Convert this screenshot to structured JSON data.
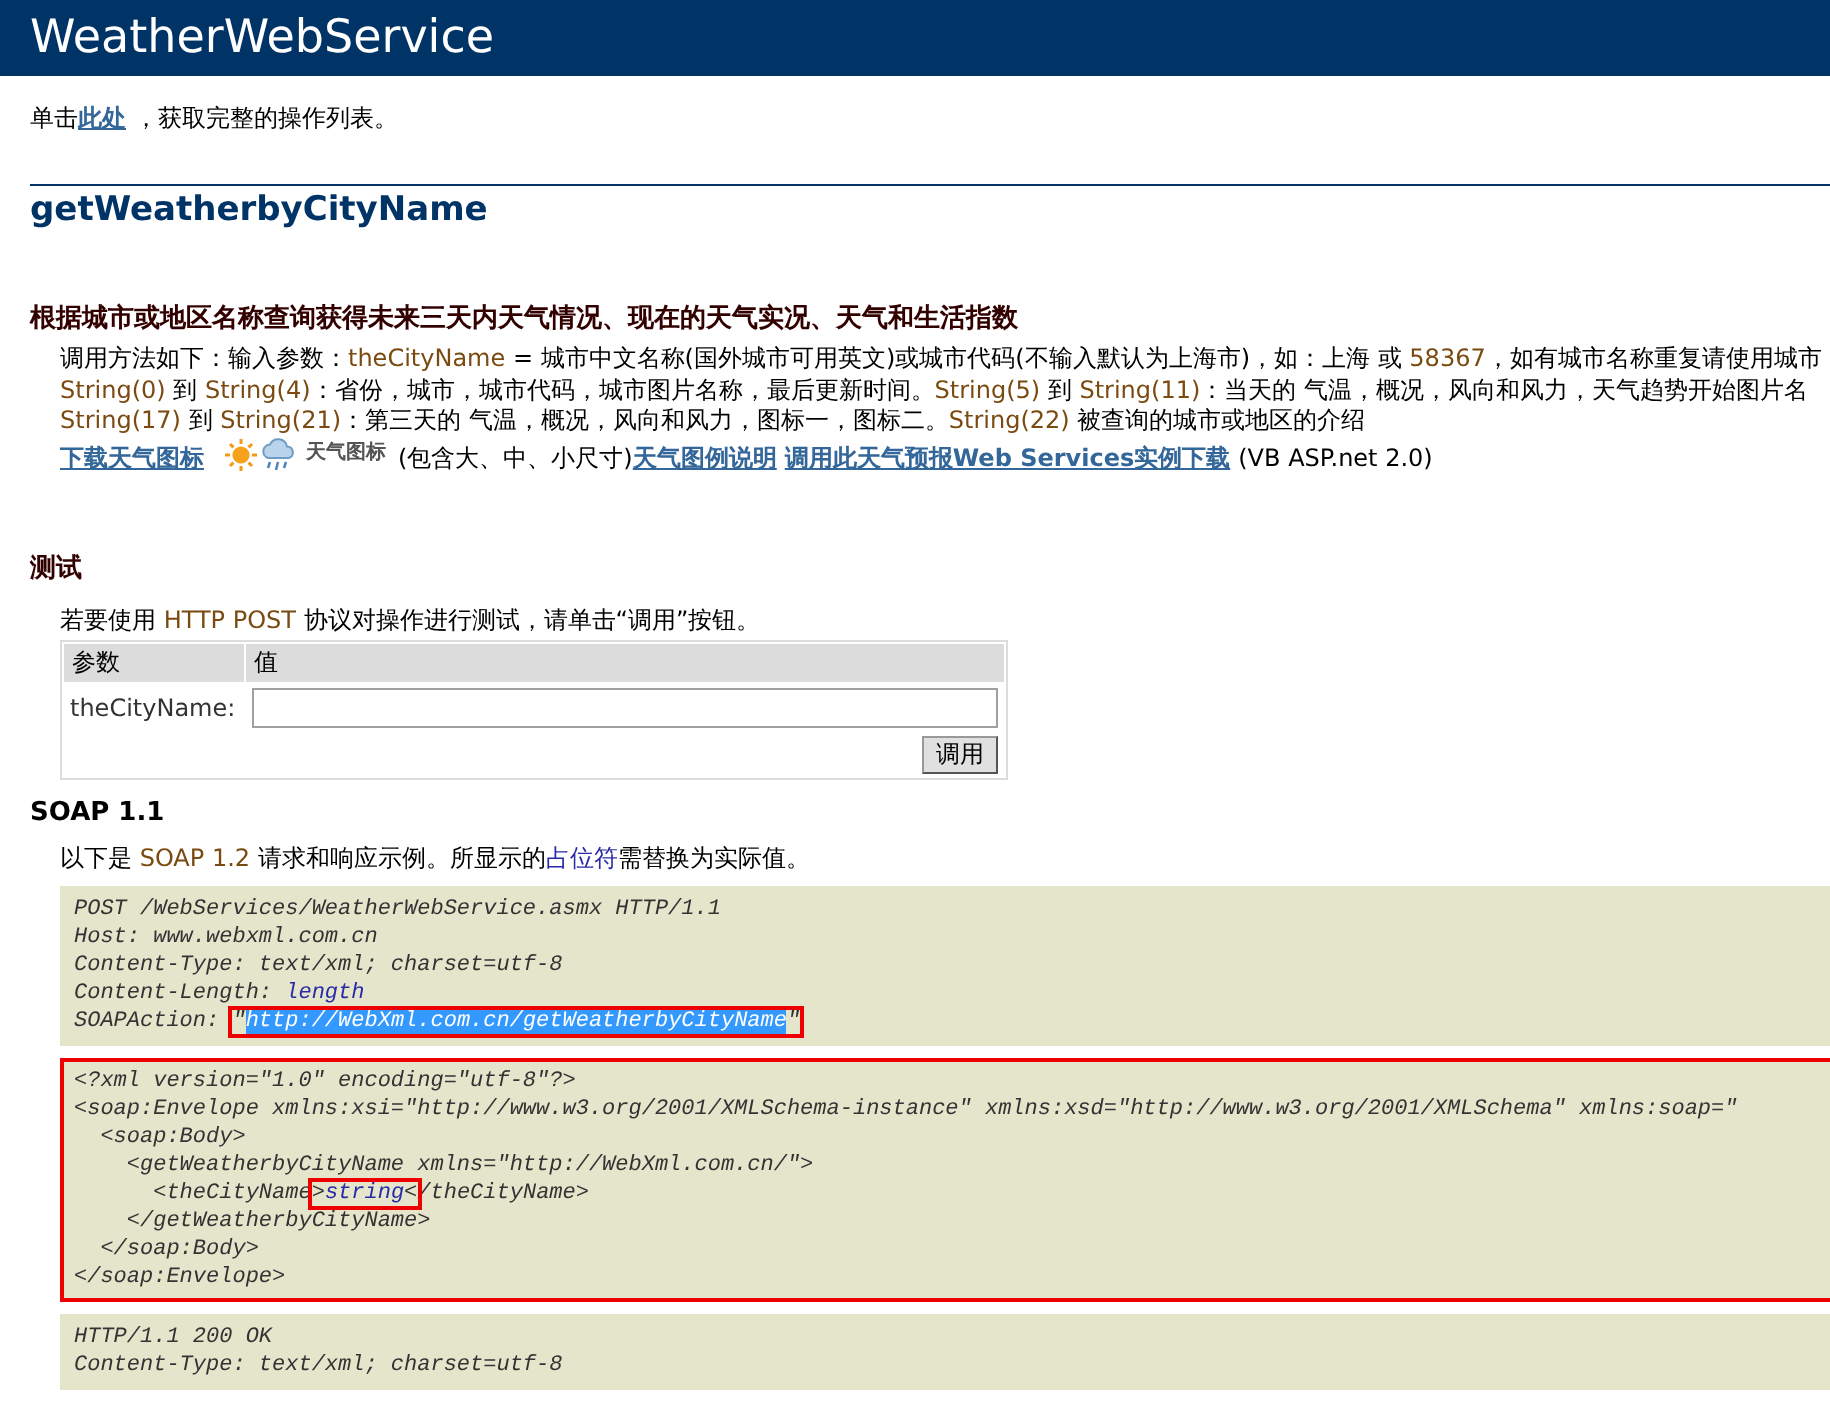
{
  "page_title": "WeatherWebService",
  "intro": [
    {
      "text": "单击"
    },
    {
      "text": "此处",
      "kind": "link"
    },
    {
      "text": "，获取完整的操作列表。"
    }
  ],
  "operation": {
    "name": "getWeatherbyCityName",
    "summary": "根据城市或地区名称查询获得未来三天内天气情况、现在的天气实况、天气和生活指数",
    "description_lines": [
      [
        {
          "text": "调用方法如下：输入参数："
        },
        {
          "text": "theCityName",
          "kind": "term"
        },
        {
          "text": " = 城市中文名称(国外城市可用英文)或城市代码(不输入默认为上海市)，如：上海 或 "
        },
        {
          "text": "58367",
          "kind": "term"
        },
        {
          "text": "，如有城市名称重复请使用城市"
        }
      ],
      [
        {
          "text": "String(0)",
          "kind": "term"
        },
        {
          "text": " 到 "
        },
        {
          "text": "String(4)",
          "kind": "term"
        },
        {
          "text": "：省份，城市，城市代码，城市图片名称，最后更新时间。"
        },
        {
          "text": "String(5)",
          "kind": "term"
        },
        {
          "text": " 到 "
        },
        {
          "text": "String(11)",
          "kind": "term"
        },
        {
          "text": "：当天的 气温，概况，风向和风力，天气趋势开始图片名"
        }
      ],
      [
        {
          "text": "String(17)",
          "kind": "term"
        },
        {
          "text": " 到 "
        },
        {
          "text": "String(21)",
          "kind": "term"
        },
        {
          "text": "：第三天的 气温，概况，风向和风力，图标一，图标二。"
        },
        {
          "text": "String(22)",
          "kind": "term"
        },
        {
          "text": " 被查询的城市或地区的介绍"
        }
      ],
      [
        {
          "text": "下载天气图标",
          "kind": "link"
        },
        {
          "text": "天气图标",
          "kind": "weather-icons"
        },
        {
          "text": "(包含大、中、小尺寸)"
        },
        {
          "text": "天气图例说明",
          "kind": "link"
        },
        {
          "text": "调用此天气预报Web Services实例下载",
          "kind": "link"
        },
        {
          "text": "(VB ASP.net 2.0)"
        }
      ]
    ]
  },
  "test": {
    "heading": "测试",
    "intro": [
      {
        "text": "若要使用 "
      },
      {
        "text": "HTTP POST",
        "kind": "term"
      },
      {
        "text": " 协议对操作进行测试，请单击“调用”按钮。"
      }
    ],
    "columns": [
      "参数",
      "值"
    ],
    "parameters": [
      {
        "label": "theCityName:"
      }
    ],
    "button": "调用"
  },
  "soap11": {
    "heading": "SOAP 1.1",
    "intro": [
      {
        "text": "以下是 "
      },
      {
        "text": "SOAP 1.2",
        "kind": "term"
      },
      {
        "text": " 请求和响应示例。所显示的"
      },
      {
        "text": "占位符",
        "kind": "placeholder"
      },
      {
        "text": "需替换为实际值。"
      }
    ],
    "blocks": [
      {
        "boxed": false,
        "lines": [
          [
            {
              "text": "POST /WebServices/WeatherWebService.asmx HTTP/1.1"
            }
          ],
          [
            {
              "text": "Host: www.webxml.com.cn"
            }
          ],
          [
            {
              "text": "Content-Type: text/xml; charset=utf-8"
            }
          ],
          [
            {
              "text": "Content-Length: "
            },
            {
              "text": "length",
              "kind": "placeholder"
            }
          ],
          [
            {
              "text": "SOAPAction: "
            },
            {
              "kind": "group",
              "boxed": true,
              "parts": [
                {
                  "text": "\""
                },
                {
                  "text": "http://WebXml.com.cn/getWeatherbyCityName",
                  "kind": "selected"
                },
                {
                  "text": "\""
                }
              ]
            }
          ]
        ]
      },
      {
        "boxed": true,
        "lines": [
          [
            {
              "text": "<?xml version=\"1.0\" encoding=\"utf-8\"?>"
            }
          ],
          [
            {
              "text": "<soap:Envelope xmlns:xsi=\"http://www.w3.org/2001/XMLSchema-instance\" xmlns:xsd=\"http://www.w3.org/2001/XMLSchema\" xmlns:soap=\""
            }
          ],
          [
            {
              "text": "  <soap:Body>"
            }
          ],
          [
            {
              "text": "    <getWeatherbyCityName xmlns=\"http://WebXml.com.cn/\">"
            }
          ],
          [
            {
              "text": "      <theCityName"
            },
            {
              "kind": "group",
              "boxed": true,
              "parts": [
                {
                  "text": ">"
                },
                {
                  "text": "string",
                  "kind": "placeholder"
                },
                {
                  "text": "<"
                }
              ]
            },
            {
              "text": "/theCityName>"
            }
          ],
          [
            {
              "text": "    </getWeatherbyCityName>"
            }
          ],
          [
            {
              "text": "  </soap:Body>"
            }
          ],
          [
            {
              "text": "</soap:Envelope>"
            }
          ]
        ]
      },
      {
        "boxed": false,
        "lines": [
          [
            {
              "text": "HTTP/1.1 200 OK"
            }
          ],
          [
            {
              "text": "Content-Type: text/xml; charset=utf-8"
            }
          ]
        ]
      }
    ]
  }
}
